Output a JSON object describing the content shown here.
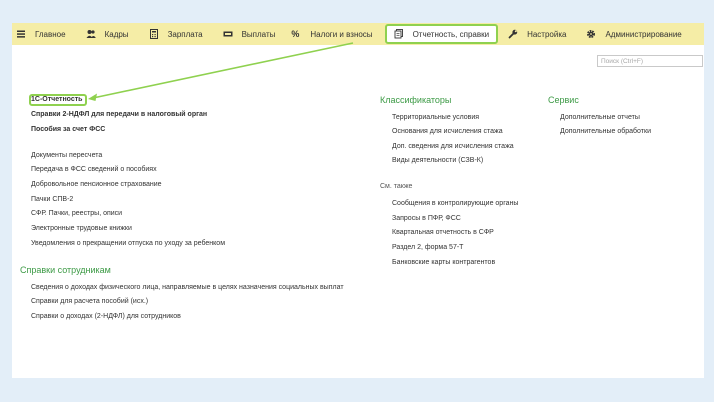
{
  "menu": {
    "items": [
      {
        "label": "Главное",
        "icon": "hamburger-icon"
      },
      {
        "label": "Кадры",
        "icon": "people-icon"
      },
      {
        "label": "Зарплата",
        "icon": "calculator-icon"
      },
      {
        "label": "Выплаты",
        "icon": "wallet-icon"
      },
      {
        "label": "Налоги и взносы",
        "icon": "percent-icon"
      },
      {
        "label": "Отчетность, справки",
        "icon": "documents-icon"
      },
      {
        "label": "Настройка",
        "icon": "wrench-icon"
      },
      {
        "label": "Администрирование",
        "icon": "gear-icon"
      }
    ]
  },
  "search": {
    "placeholder": "Поиск (Ctrl+F)"
  },
  "left": {
    "primary": [
      "1С-Отчетность",
      "Справки 2-НДФЛ для передачи в налоговый орган",
      "Пособия за счет ФСС"
    ],
    "links": [
      "Документы пересчета",
      "Передача в ФСС сведений о пособиях",
      "Добровольное пенсионное страхование",
      "Пачки СПВ-2",
      "СФР. Пачки, реестры, описи",
      "Электронные трудовые книжки",
      "Уведомления о прекращении отпуска по уходу за ребенком"
    ],
    "employees_heading": "Справки сотрудникам",
    "employees_links": [
      "Сведения о доходах физического лица, направляемые в целях назначения социальных выплат",
      "Справки для расчета пособий (исх.)",
      "Справки о доходах (2-НДФЛ) для сотрудников"
    ]
  },
  "middle": {
    "heading": "Классификаторы",
    "links": [
      "Территориальные условия",
      "Основания для исчисления стажа",
      "Доп. сведения для исчисления стажа",
      "Виды деятельности (СЗВ-К)"
    ],
    "see_also_label": "См. также",
    "see_also_links": [
      "Сообщения в контролирующие органы",
      "Запросы в ПФР, ФСС",
      "Квартальная отчетность в СФР",
      "Раздел 2, форма 57-Т",
      "Банковские карты контрагентов"
    ]
  },
  "right": {
    "heading": "Сервис",
    "links": [
      "Дополнительные отчеты",
      "Дополнительные обработки"
    ]
  },
  "colors": {
    "menubar": "#f5eda6",
    "highlight": "#8fd14f",
    "heading": "#3c9a45",
    "background": "#e3eef8"
  }
}
